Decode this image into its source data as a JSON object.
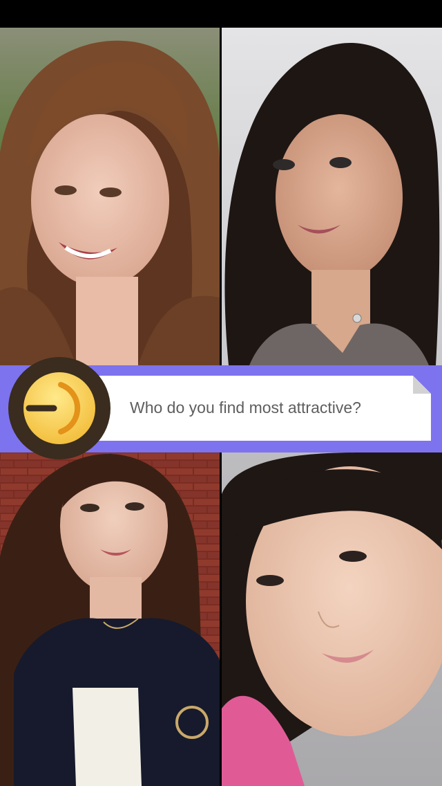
{
  "question": {
    "text": "Who do you find most attractive?"
  },
  "colors": {
    "band": "#7d73ee",
    "card": "#ffffff",
    "text": "#5e5e5e",
    "logo_ring": "#3a2c1e",
    "logo_face": "#f6c746",
    "logo_accent": "#e3921a"
  },
  "icons": {
    "logo": "app-logo-icon"
  },
  "photos": [
    {
      "id": "photo-top-left"
    },
    {
      "id": "photo-top-right"
    },
    {
      "id": "photo-bottom-left"
    },
    {
      "id": "photo-bottom-right"
    }
  ]
}
